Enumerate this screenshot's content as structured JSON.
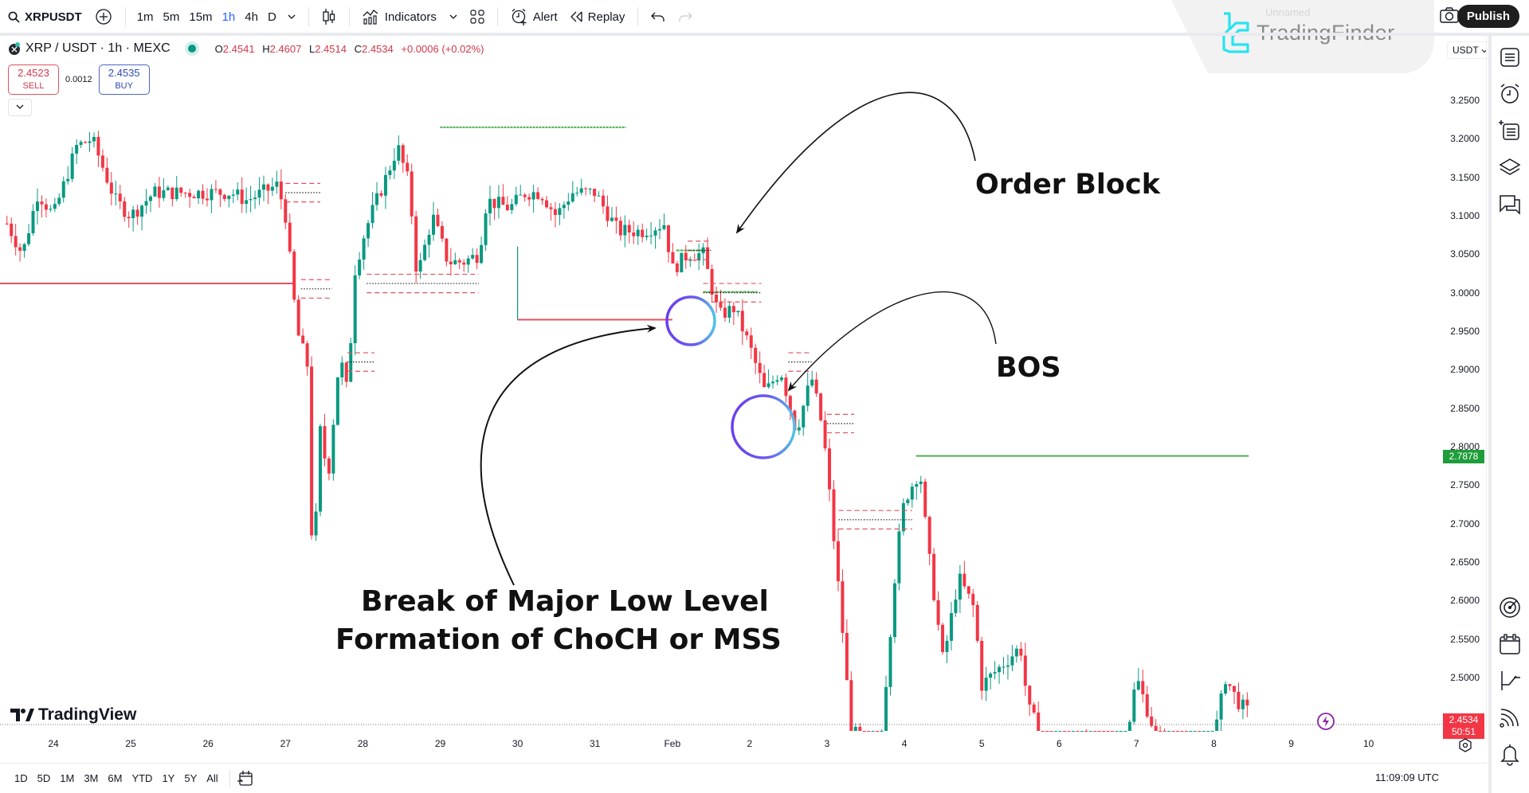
{
  "toolbar": {
    "symbol": "XRPUSDT",
    "timeframes": [
      "1m",
      "5m",
      "15m",
      "1h",
      "4h",
      "D"
    ],
    "active_timeframe": "1h",
    "indicators_label": "Indicators",
    "alert_label": "Alert",
    "replay_label": "Replay",
    "publish_label": "Publish"
  },
  "watermark": {
    "brand": "TradingFinder",
    "ghost_text": "Unnamed"
  },
  "legend": {
    "title": "XRP / USDT · 1h · MEXC",
    "open_label": "O",
    "open": "2.4541",
    "high_label": "H",
    "high": "2.4607",
    "low_label": "L",
    "low": "2.4514",
    "close_label": "C",
    "close": "2.4534",
    "change": "+0.0006 (+0.02%)"
  },
  "trade": {
    "sell_price": "2.4523",
    "sell_label": "SELL",
    "spread": "0.0012",
    "buy_price": "2.4535",
    "buy_label": "BUY"
  },
  "price_axis": {
    "currency": "USDT",
    "ticks": [
      "3.2500",
      "3.2000",
      "3.1500",
      "3.1000",
      "3.0500",
      "3.0000",
      "2.9500",
      "2.9000",
      "2.8500",
      "2.8000",
      "2.7500",
      "2.7000",
      "2.6500",
      "2.6000",
      "2.5500",
      "2.5000"
    ],
    "level_badge": "2.7878",
    "level_badge_color": "#1e9d3a",
    "last_price_badge": "2.4534",
    "countdown": "50:51",
    "last_price_color": "#f23645"
  },
  "time_axis": {
    "ticks": [
      "24",
      "25",
      "26",
      "27",
      "28",
      "29",
      "30",
      "31",
      "Feb",
      "2",
      "3",
      "4",
      "5",
      "6",
      "7",
      "8",
      "9",
      "10"
    ]
  },
  "bottom_bar": {
    "ranges": [
      "1D",
      "5D",
      "1M",
      "3M",
      "6M",
      "YTD",
      "1Y",
      "5Y",
      "All"
    ],
    "clock": "11:09:09 UTC"
  },
  "branding": {
    "tradingview": "TradingView"
  },
  "annotations": {
    "order_block": "Order Block",
    "bos": "BOS",
    "choch_line1": "Break of Major Low Level",
    "choch_line2": "Formation of ChoCH or MSS"
  },
  "colors": {
    "up": "#089981",
    "down": "#f23645",
    "level_green": "#4caf50",
    "level_red": "#e0525e",
    "circle_from": "#6a3df0",
    "circle_to": "#4fc3e8"
  },
  "chart_data": {
    "type": "candlestick",
    "symbol": "XRP/USDT",
    "interval": "1h",
    "exchange": "MEXC",
    "ylim": [
      2.45,
      3.27
    ],
    "x_ticks": [
      "24",
      "25",
      "26",
      "27",
      "28",
      "29",
      "30",
      "31",
      "Feb",
      "2",
      "3",
      "4",
      "5",
      "6",
      "7",
      "8",
      "9",
      "10"
    ],
    "path_points": [
      {
        "day": 23.4,
        "price": 3.09
      },
      {
        "day": 23.6,
        "price": 3.05
      },
      {
        "day": 23.8,
        "price": 3.13
      },
      {
        "day": 24.0,
        "price": 3.1
      },
      {
        "day": 24.3,
        "price": 3.19
      },
      {
        "day": 24.5,
        "price": 3.2
      },
      {
        "day": 24.8,
        "price": 3.12
      },
      {
        "day": 25.0,
        "price": 3.1
      },
      {
        "day": 25.3,
        "price": 3.13
      },
      {
        "day": 25.7,
        "price": 3.13
      },
      {
        "day": 26.0,
        "price": 3.13
      },
      {
        "day": 26.3,
        "price": 3.13
      },
      {
        "day": 26.5,
        "price": 3.12
      },
      {
        "day": 26.9,
        "price": 3.14
      },
      {
        "day": 27.0,
        "price": 3.1
      },
      {
        "day": 27.15,
        "price": 2.95
      },
      {
        "day": 27.3,
        "price": 2.9
      },
      {
        "day": 27.35,
        "price": 2.62
      },
      {
        "day": 27.45,
        "price": 2.82
      },
      {
        "day": 27.55,
        "price": 2.76
      },
      {
        "day": 27.7,
        "price": 2.92
      },
      {
        "day": 27.8,
        "price": 2.87
      },
      {
        "day": 27.9,
        "price": 3.03
      },
      {
        "day": 28.0,
        "price": 3.07
      },
      {
        "day": 28.1,
        "price": 3.1
      },
      {
        "day": 28.3,
        "price": 3.15
      },
      {
        "day": 28.45,
        "price": 3.19
      },
      {
        "day": 28.6,
        "price": 3.14
      },
      {
        "day": 28.7,
        "price": 3.02
      },
      {
        "day": 28.9,
        "price": 3.1
      },
      {
        "day": 29.1,
        "price": 3.04
      },
      {
        "day": 29.3,
        "price": 3.04
      },
      {
        "day": 29.5,
        "price": 3.05
      },
      {
        "day": 29.6,
        "price": 3.12
      },
      {
        "day": 29.9,
        "price": 3.11
      },
      {
        "day": 30.1,
        "price": 3.13
      },
      {
        "day": 30.3,
        "price": 3.13
      },
      {
        "day": 30.5,
        "price": 3.1
      },
      {
        "day": 30.7,
        "price": 3.13
      },
      {
        "day": 31.0,
        "price": 3.13
      },
      {
        "day": 31.3,
        "price": 3.08
      },
      {
        "day": 31.6,
        "price": 3.08
      },
      {
        "day": 31.9,
        "price": 3.09
      },
      {
        "day": 32.0,
        "price": 3.03
      },
      {
        "day": 32.2,
        "price": 3.05
      },
      {
        "day": 32.4,
        "price": 3.05
      },
      {
        "day": 32.6,
        "price": 2.97
      },
      {
        "day": 32.8,
        "price": 2.98
      },
      {
        "day": 33.0,
        "price": 2.93
      },
      {
        "day": 33.2,
        "price": 2.87
      },
      {
        "day": 33.4,
        "price": 2.9
      },
      {
        "day": 33.6,
        "price": 2.82
      },
      {
        "day": 33.8,
        "price": 2.89
      },
      {
        "day": 33.95,
        "price": 2.82
      },
      {
        "day": 34.05,
        "price": 2.72
      },
      {
        "day": 34.2,
        "price": 2.56
      },
      {
        "day": 34.3,
        "price": 2.44
      },
      {
        "day": 34.5,
        "price": 2.4
      },
      {
        "day": 34.7,
        "price": 2.42
      },
      {
        "day": 34.9,
        "price": 2.66
      },
      {
        "day": 35.0,
        "price": 2.73
      },
      {
        "day": 35.2,
        "price": 2.77
      },
      {
        "day": 35.3,
        "price": 2.67
      },
      {
        "day": 35.5,
        "price": 2.52
      },
      {
        "day": 35.7,
        "price": 2.63
      },
      {
        "day": 35.9,
        "price": 2.59
      },
      {
        "day": 36.0,
        "price": 2.49
      },
      {
        "day": 36.3,
        "price": 2.52
      },
      {
        "day": 36.5,
        "price": 2.54
      },
      {
        "day": 36.6,
        "price": 2.46
      },
      {
        "day": 36.9,
        "price": 2.4
      },
      {
        "day": 37.2,
        "price": 2.42
      },
      {
        "day": 37.5,
        "price": 2.39
      },
      {
        "day": 37.8,
        "price": 2.38
      },
      {
        "day": 38.0,
        "price": 2.5
      },
      {
        "day": 38.3,
        "price": 2.41
      },
      {
        "day": 38.8,
        "price": 2.39
      },
      {
        "day": 39.0,
        "price": 2.42
      },
      {
        "day": 39.15,
        "price": 2.5
      },
      {
        "day": 39.3,
        "price": 2.47
      },
      {
        "day": 39.45,
        "price": 2.4534
      }
    ],
    "levels": [
      {
        "kind": "swing-high",
        "price": 3.215,
        "from_day": 29.0,
        "to_day": 31.4,
        "color": "green"
      },
      {
        "kind": "major-low",
        "price": 3.012,
        "from_day": 23.0,
        "to_day": 27.1,
        "color": "red"
      },
      {
        "kind": "major-low-break",
        "price": 2.965,
        "from_day": 30.0,
        "to_day": 32.0,
        "color": "red"
      },
      {
        "kind": "high",
        "price": 2.788,
        "from_day": 35.15,
        "to_day": 39.45,
        "color": "green"
      },
      {
        "kind": "order-block",
        "price": 3.055,
        "from_day": 32.05,
        "to_day": 32.4,
        "color": "green"
      },
      {
        "kind": "order-block-2",
        "price": 3.001,
        "from_day": 32.4,
        "to_day": 33.1,
        "color": "green"
      }
    ]
  }
}
